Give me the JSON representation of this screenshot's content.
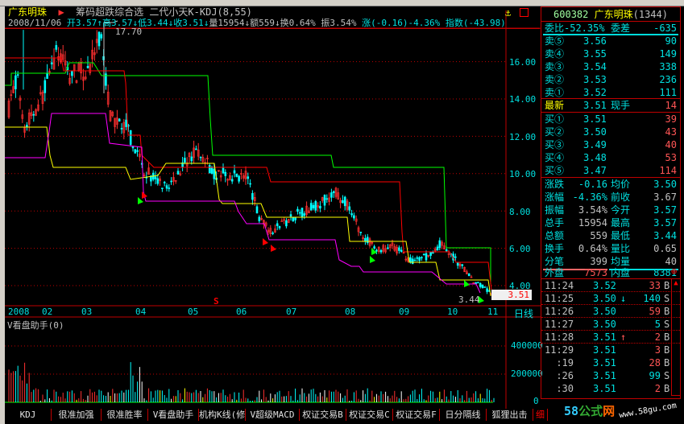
{
  "header": {
    "stock_name": "广东明珠",
    "formula": "筹码超跌综合选",
    "indicator": "二代小天K-KDJ(8,55)"
  },
  "info": {
    "date": "2008/11/06",
    "open": "开3.57",
    "high": "高3.57",
    "low": "低3.44",
    "close": "收3.51",
    "volume": "量15954",
    "amount": "额559",
    "turnover": "换0.64%",
    "amplitude": "振3.54%",
    "change": "涨(-0.16)-4.36%",
    "index": "指数(-43.98)"
  },
  "chart": {
    "high_label": "17.70",
    "low_label": "3.44",
    "last_price": "3.51",
    "signal": "S",
    "price_ticks": [
      "16.00",
      "14.00",
      "12.00",
      "10.00",
      "8.00",
      "6.00",
      "4.00"
    ],
    "months": [
      "2008",
      "02",
      "03",
      "04",
      "05",
      "06",
      "07",
      "08",
      "09",
      "10",
      "11"
    ],
    "period": "日线",
    "volume_title": "V看盘助手(0)",
    "volume_ticks": [
      "400000",
      "200000",
      "0"
    ],
    "colors": {
      "up": "#ff3030",
      "down": "#00ffff",
      "grid": "#c00000"
    }
  },
  "quote": {
    "code": "600382",
    "name": "广东明珠",
    "rank": "(1344)",
    "weibi_label": "委比",
    "weibi": "-52.35%",
    "weicha_label": "委差",
    "weicha": "-635",
    "sells": [
      {
        "l": "卖⑤",
        "p": "3.56",
        "v": "90"
      },
      {
        "l": "卖④",
        "p": "3.55",
        "v": "149"
      },
      {
        "l": "卖③",
        "p": "3.54",
        "v": "338"
      },
      {
        "l": "卖②",
        "p": "3.53",
        "v": "236"
      },
      {
        "l": "卖①",
        "p": "3.52",
        "v": "111"
      }
    ],
    "latest_label": "最新",
    "latest": "3.51",
    "now_label": "现手",
    "now": "14",
    "buys": [
      {
        "l": "买①",
        "p": "3.51",
        "v": "39"
      },
      {
        "l": "买②",
        "p": "3.50",
        "v": "43"
      },
      {
        "l": "买③",
        "p": "3.49",
        "v": "40"
      },
      {
        "l": "买④",
        "p": "3.48",
        "v": "53"
      },
      {
        "l": "买⑤",
        "p": "3.47",
        "v": "114"
      }
    ],
    "stats": [
      {
        "l1": "涨跌",
        "v1": "-0.16",
        "l2": "均价",
        "v2": "3.50"
      },
      {
        "l1": "涨幅",
        "v1": "-4.36%",
        "l2": "前收",
        "v2": "3.67"
      },
      {
        "l1": "振幅",
        "v1": "3.54%",
        "l2": "今开",
        "v2": "3.57"
      },
      {
        "l1": "总手",
        "v1": "15954",
        "l2": "最高",
        "v2": "3.57"
      },
      {
        "l1": "总额",
        "v1": "559",
        "l2": "最低",
        "v2": "3.44"
      },
      {
        "l1": "换手",
        "v1": "0.64%",
        "l2": "量比",
        "v2": "0.65"
      },
      {
        "l1": "分笔",
        "v1": "399",
        "l2": "均量",
        "v2": "40"
      }
    ],
    "outer_label": "外盘",
    "outer": "7573",
    "inner_label": "内盘",
    "inner": "8381",
    "ticks": [
      {
        "t": "11:24",
        "p": "3.52",
        "a": "",
        "v": "33",
        "s": "B"
      },
      {
        "t": "11:25",
        "p": "3.50",
        "a": "↓",
        "v": "140",
        "s": "S"
      },
      {
        "t": "11:26",
        "p": "3.50",
        "a": "",
        "v": "59",
        "s": "B"
      },
      {
        "t": "11:27",
        "p": "3.50",
        "a": "",
        "v": "5",
        "s": "S"
      },
      {
        "t": "11:28",
        "p": "3.51",
        "a": "↑",
        "v": "2",
        "s": "B"
      },
      {
        "t": "11:29",
        "p": "3.51",
        "a": "",
        "v": "3",
        "s": "B"
      },
      {
        "t": ":19",
        "p": "3.51",
        "a": "",
        "v": "28",
        "s": "B"
      },
      {
        "t": ":26",
        "p": "3.51",
        "a": "",
        "v": "99",
        "s": "S"
      },
      {
        "t": ":30",
        "p": "3.51",
        "a": "",
        "v": "2",
        "s": "B"
      }
    ]
  },
  "tabs": [
    "KDJ",
    "很准加强",
    "很准胜率",
    "V看盘助手",
    "机构K线(修",
    "V超级MACD",
    "权证交易B",
    "权证交易C",
    "权证交易F",
    "日分隔线",
    "狐狸出击",
    "细"
  ],
  "watermark": {
    "brand": "58公式网",
    "url": "www.58gu.com"
  }
}
